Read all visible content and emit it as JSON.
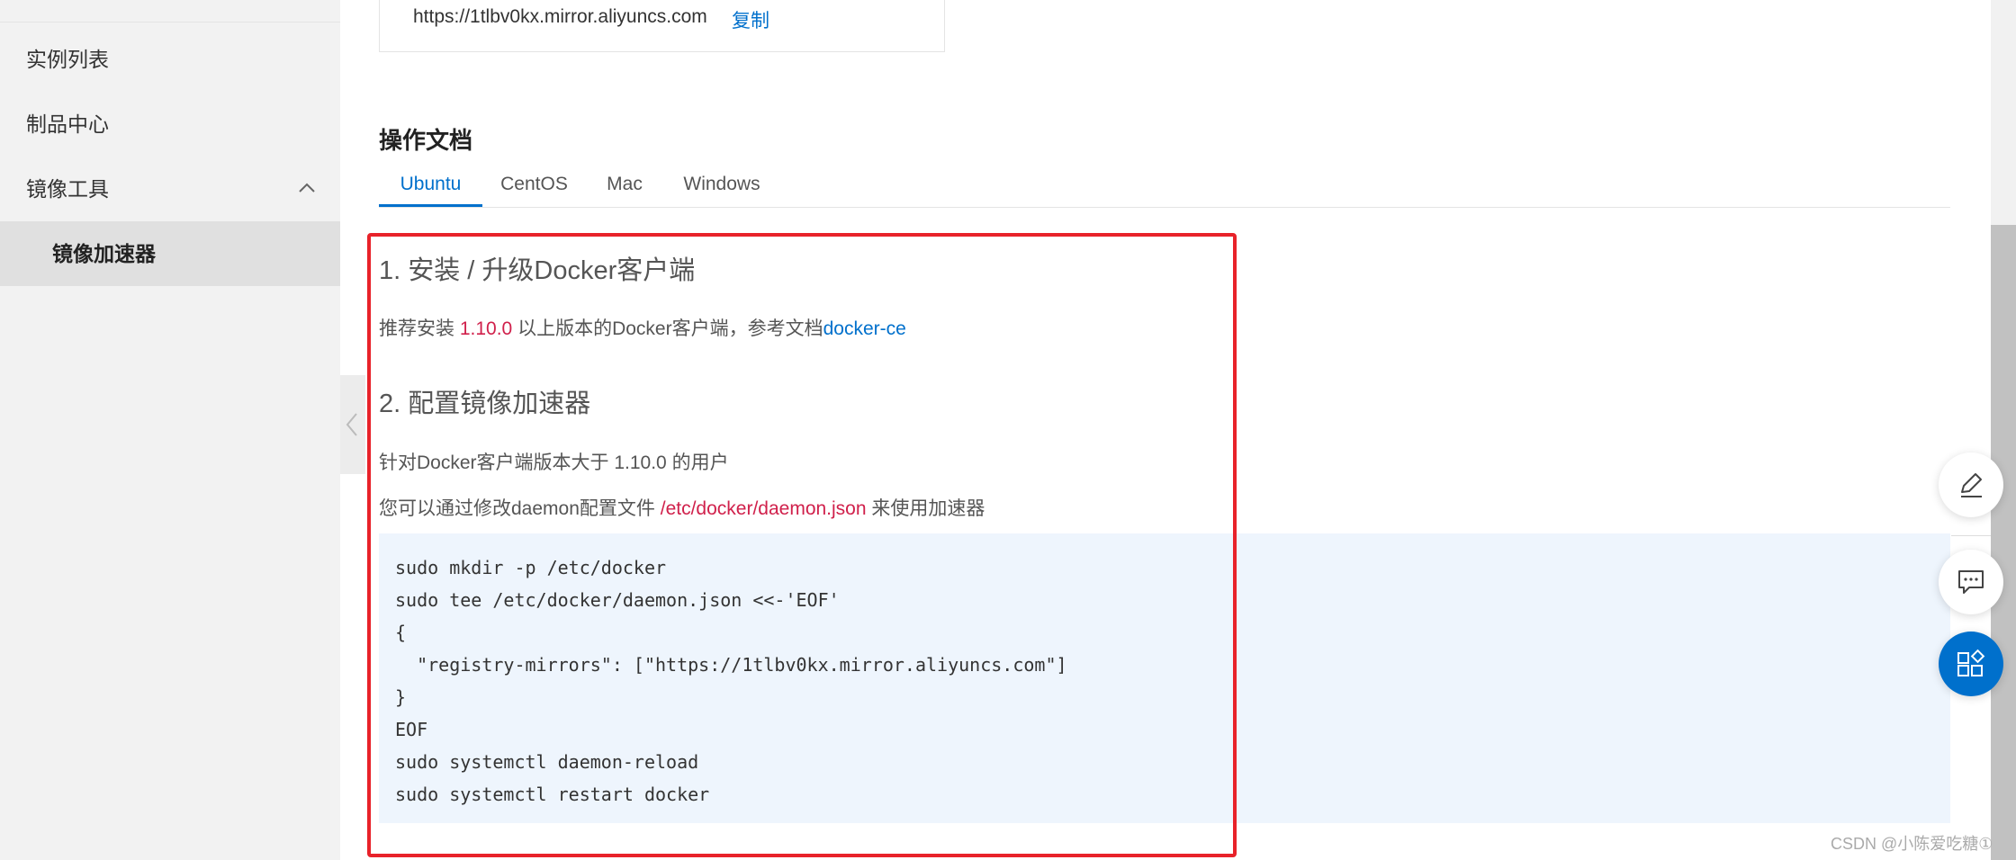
{
  "sidebar": {
    "items": [
      {
        "label": "实例列表"
      },
      {
        "label": "制品中心"
      },
      {
        "label": "镜像工具"
      },
      {
        "label": "镜像加速器"
      }
    ]
  },
  "accelerator": {
    "url": "https://1tlbv0kx.mirror.aliyuncs.com",
    "copy_label": "复制"
  },
  "docs": {
    "title": "操作文档",
    "tabs": [
      "Ubuntu",
      "CentOS",
      "Mac",
      "Windows"
    ],
    "step1": {
      "heading": "1. 安装 / 升级Docker客户端",
      "text_prefix": "推荐安装 ",
      "version": "1.10.0",
      "text_middle": " 以上版本的Docker客户端，参考文档",
      "link": "docker-ce"
    },
    "step2": {
      "heading": "2. 配置镜像加速器",
      "line1": "针对Docker客户端版本大于 1.10.0 的用户",
      "line2_prefix": "您可以通过修改daemon配置文件 ",
      "path": "/etc/docker/daemon.json",
      "line2_suffix": " 来使用加速器"
    },
    "code": [
      "sudo mkdir -p /etc/docker",
      "sudo tee /etc/docker/daemon.json <<-'EOF'",
      "{",
      "  \"registry-mirrors\": [\"https://1tlbv0kx.mirror.aliyuncs.com\"]",
      "}",
      "EOF",
      "sudo systemctl daemon-reload",
      "sudo systemctl restart docker"
    ]
  },
  "floating": {
    "icons": [
      "edit-icon",
      "chat-icon",
      "apps-icon"
    ],
    "primary_color": "#0070cc"
  },
  "watermark": "CSDN @小陈爱吃糖①"
}
